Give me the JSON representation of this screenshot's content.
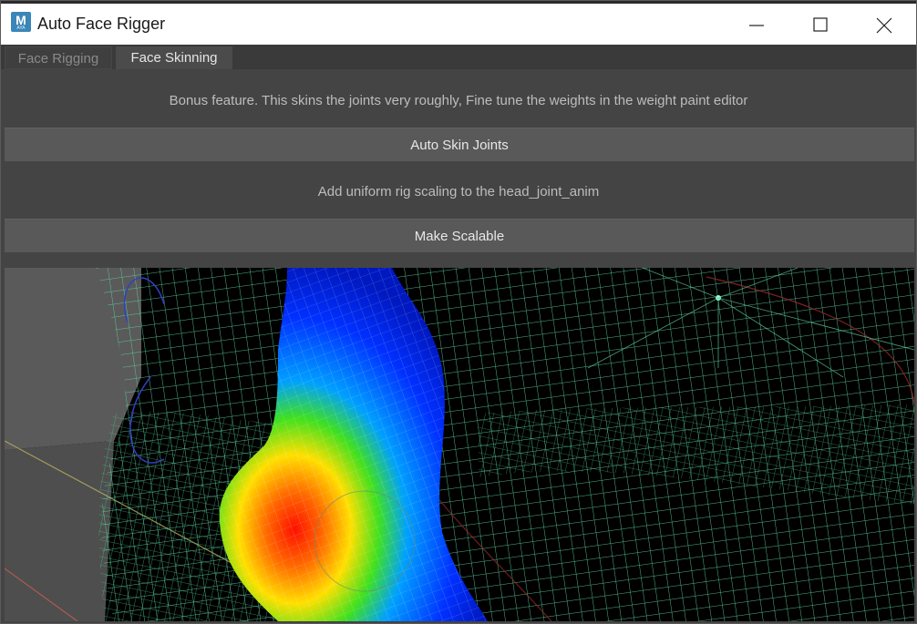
{
  "window": {
    "title": "Auto Face Rigger",
    "app_icon_letter": "M",
    "app_icon_sub": "AYA"
  },
  "tabs": [
    {
      "label": "Face Rigging",
      "active": false
    },
    {
      "label": "Face Skinning",
      "active": true
    }
  ],
  "skinning": {
    "info_text": "Bonus feature. This skins the joints very roughly, Fine tune the weights in the weight paint editor",
    "auto_skin_button": "Auto Skin Joints",
    "scaling_text": "Add uniform rig scaling to the head_joint_anim",
    "make_scalable_button": "Make Scalable"
  },
  "viewport": {
    "content": "weight-paint-heatmap",
    "colors": {
      "mesh": "#5fd3a0",
      "hot": "#ff1a00",
      "mid": "#ffe000",
      "cold": "#0033ff",
      "background": "#000000",
      "ground": "#5a5a5a"
    }
  }
}
